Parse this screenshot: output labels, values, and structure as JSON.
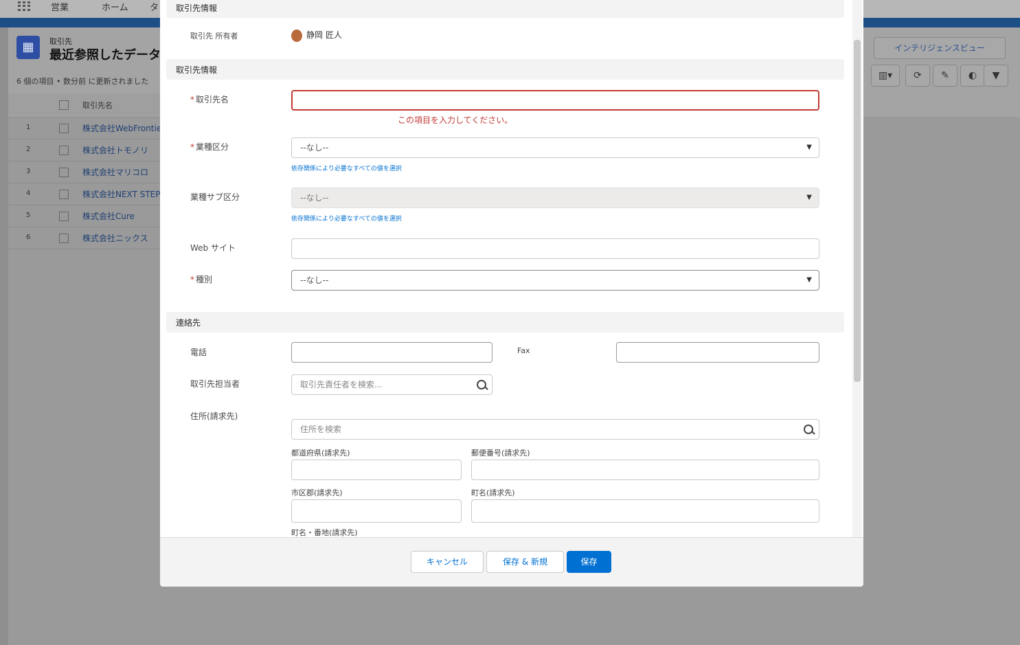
{
  "topbar": {
    "app_name": "営業",
    "nav1": "ホーム",
    "nav2": "タ"
  },
  "header": {
    "object_type": "取引先",
    "list_name": "最近参照したデータ",
    "subtitle": "6 個の項目 • 数分前 に更新されました",
    "intel_view": "インテリジェンスビュー"
  },
  "table": {
    "column": "取引先名",
    "rows": [
      {
        "num": "1",
        "name": "株式会社WebFrontier"
      },
      {
        "num": "2",
        "name": "株式会社トモノリ"
      },
      {
        "num": "3",
        "name": "株式会社マリコロ"
      },
      {
        "num": "4",
        "name": "株式会社NEXT STEP"
      },
      {
        "num": "5",
        "name": "株式会社Cure"
      },
      {
        "num": "6",
        "name": "株式会社ニックス"
      }
    ]
  },
  "modal": {
    "section_top": "取引先情報",
    "owner_label": "取引先 所有者",
    "owner_name": "静岡 匠人",
    "section_account": "取引先情報",
    "account_name_label": "取引先名",
    "account_name_value": "",
    "error_msg": "この項目を入力してください。",
    "industry_label": "業種区分",
    "industry_value": "--なし--",
    "help1": "依存関係により必要なすべての値を選択",
    "subindustry_label": "業種サブ区分",
    "subindustry_value": "--なし--",
    "help2": "依存関係により必要なすべての値を選択",
    "website_label": "Web サイト",
    "website_value": "",
    "type_label": "種別",
    "type_value": "--なし--",
    "section_contact": "連絡先",
    "phone_label": "電話",
    "phone_value": "",
    "fax_label": "Fax",
    "fax_value": "",
    "contact_owner_label": "取引先担当者",
    "contact_owner_placeholder": "取引先責任者を検索...",
    "address_label": "住所(請求先)",
    "address_search_placeholder": "住所を検索",
    "pref_label": "都道府県(請求先)",
    "zip_label": "郵便番号(請求先)",
    "city_label": "市区郡(請求先)",
    "town_label": "町名(請求先)",
    "street_label": "町名・番地(請求先)",
    "cancel": "キャンセル",
    "save_new": "保存 & 新規",
    "save": "保存"
  }
}
